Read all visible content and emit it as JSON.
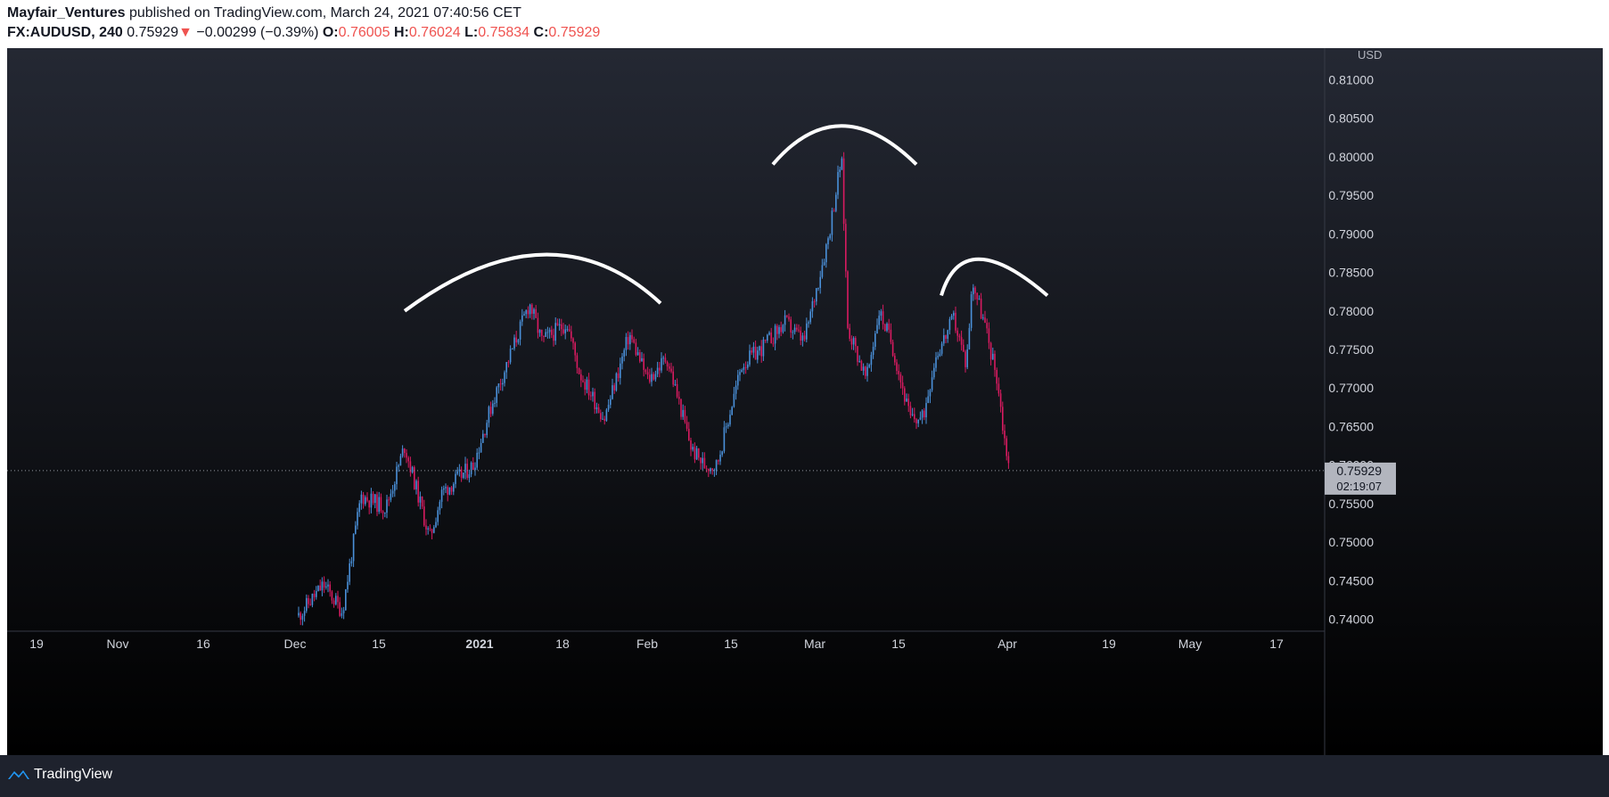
{
  "header": {
    "author": "Mayfair_Ventures",
    "published_text": "published on TradingView.com, March 24, 2021 07:40:56 CET",
    "symbol": "FX:AUDUSD, 240",
    "last": "0.75929",
    "change_arrow": "▼",
    "change": "−0.00299 (−0.39%)",
    "o_label": "O:",
    "o_value": "0.76005",
    "h_label": "H:",
    "h_value": "0.76024",
    "l_label": "L:",
    "l_value": "0.75834",
    "c_label": "C:",
    "c_value": "0.75929"
  },
  "footer": {
    "brand": "TradingView",
    "logo_icon": "tradingview-logo-icon"
  },
  "colors": {
    "up": "#4a90d9",
    "down": "#d81b60",
    "arc": "#ffffff",
    "price_line": "#9598a1",
    "bg_top": "#242833",
    "bg_bottom": "#000000"
  },
  "chart_data": {
    "type": "candlestick",
    "symbol": "FX:AUDUSD",
    "timeframe": "240",
    "currency": "USD",
    "ylim": [
      0.738,
      0.812
    ],
    "y_ticks": [
      "0.81000",
      "0.80500",
      "0.80000",
      "0.79500",
      "0.79000",
      "0.78500",
      "0.78000",
      "0.77500",
      "0.77000",
      "0.76500",
      "0.76000",
      "0.75500",
      "0.75000",
      "0.74500",
      "0.74000"
    ],
    "x_ticks": [
      "19",
      "Nov",
      "16",
      "Dec",
      "15",
      "2021",
      "18",
      "Feb",
      "15",
      "Mar",
      "15",
      "Apr",
      "19",
      "May",
      "17"
    ],
    "x_tick_bold": [
      "2021"
    ],
    "current_price": "0.75929",
    "countdown": "02:19:07",
    "price_path": [
      [
        "2020-11-30",
        0.7405
      ],
      [
        "2020-12-04",
        0.7445
      ],
      [
        "2020-12-07",
        0.741
      ],
      [
        "2020-12-10",
        0.756
      ],
      [
        "2020-12-14",
        0.7545
      ],
      [
        "2020-12-17",
        0.7625
      ],
      [
        "2020-12-21",
        0.7505
      ],
      [
        "2020-12-23",
        0.7565
      ],
      [
        "2020-12-28",
        0.76
      ],
      [
        "2020-12-31",
        0.768
      ],
      [
        "2021-01-06",
        0.781
      ],
      [
        "2021-01-08",
        0.776
      ],
      [
        "2021-01-12",
        0.7785
      ],
      [
        "2021-01-14",
        0.772
      ],
      [
        "2021-01-18",
        0.766
      ],
      [
        "2021-01-22",
        0.777
      ],
      [
        "2021-01-25",
        0.771
      ],
      [
        "2021-01-28",
        0.774
      ],
      [
        "2021-02-01",
        0.762
      ],
      [
        "2021-02-03",
        0.76
      ],
      [
        "2021-02-05",
        0.76
      ],
      [
        "2021-02-09",
        0.773
      ],
      [
        "2021-02-12",
        0.775
      ],
      [
        "2021-02-16",
        0.7785
      ],
      [
        "2021-02-19",
        0.776
      ],
      [
        "2021-02-23",
        0.79
      ],
      [
        "2021-02-25",
        0.8
      ],
      [
        "2021-02-26",
        0.778
      ],
      [
        "2021-03-01",
        0.771
      ],
      [
        "2021-03-03",
        0.78
      ],
      [
        "2021-03-05",
        0.776
      ],
      [
        "2021-03-08",
        0.766
      ],
      [
        "2021-03-10",
        0.766
      ],
      [
        "2021-03-12",
        0.774
      ],
      [
        "2021-03-15",
        0.779
      ],
      [
        "2021-03-17",
        0.773
      ],
      [
        "2021-03-18",
        0.784
      ],
      [
        "2021-03-20",
        0.778
      ],
      [
        "2021-03-22",
        0.771
      ],
      [
        "2021-03-23",
        0.764
      ],
      [
        "2021-03-24",
        0.7593
      ]
    ],
    "annotations": [
      {
        "type": "arc",
        "label": "",
        "from": [
          "2020-12-17",
          0.78
        ],
        "peak": [
          "2021-01-08",
          0.7873
        ],
        "to": [
          "2021-01-27",
          0.781
        ]
      },
      {
        "type": "arc",
        "label": "",
        "from": [
          "2021-02-14",
          0.799
        ],
        "peak": [
          "2021-02-25",
          0.804
        ],
        "to": [
          "2021-03-09",
          0.799
        ]
      },
      {
        "type": "arc",
        "label": "",
        "from": [
          "2021-03-13",
          0.782
        ],
        "peak": [
          "2021-03-19",
          0.7867
        ],
        "to": [
          "2021-03-30",
          0.782
        ]
      }
    ]
  }
}
